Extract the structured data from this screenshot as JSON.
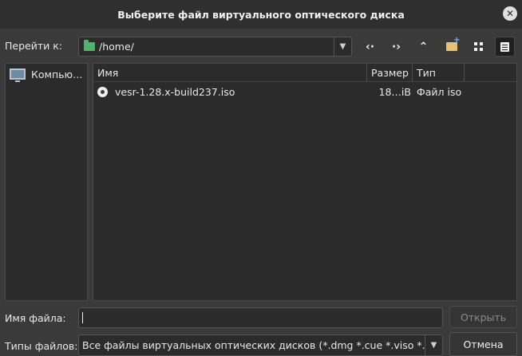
{
  "dialog": {
    "title": "Выберите файл виртуального оптического диска",
    "close_icon": "close-icon"
  },
  "toolbar": {
    "goto_label": "Перейти к:",
    "path": "/home/",
    "icons": [
      "back-arrow-icon",
      "forward-arrow-icon",
      "parent-folder-icon",
      "new-folder-icon",
      "detail-view-icon",
      "list-view-icon"
    ],
    "folder_color": "#4fb36a"
  },
  "sidebar": {
    "items": [
      {
        "label": "Компью…",
        "icon": "computer-icon"
      }
    ]
  },
  "filelist": {
    "columns": [
      "Имя",
      "Размер",
      "Тип"
    ],
    "rows": [
      {
        "name": "vesr-1.28.x-build237.iso",
        "size": "18…iB",
        "type": "Файл iso",
        "icon": "disc-icon"
      }
    ]
  },
  "footer": {
    "filename_label": "Имя файла:",
    "filename_value": "",
    "open_button": "Открыть",
    "filetype_label": "Типы файлов:",
    "filetype_value": "Все файлы виртуальных оптических дисков (*.dmg *.cue *.viso *.iso *.cc",
    "cancel_button": "Отмена"
  }
}
